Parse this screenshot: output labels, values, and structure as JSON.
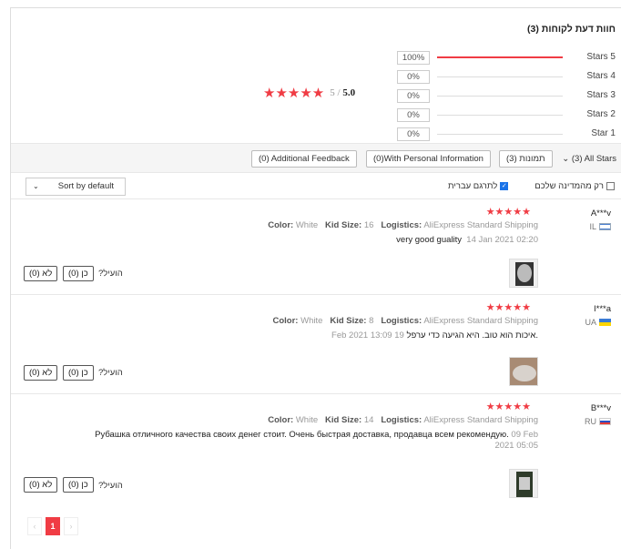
{
  "summary": {
    "title": "חוות דעת לקוחות (3)",
    "stars": "★★★★★",
    "score_max": "5 / ",
    "score": "5.0",
    "bars": [
      {
        "pct": "100%",
        "fill": 1.0,
        "label": "Stars 5"
      },
      {
        "pct": "0%",
        "fill": 0,
        "label": "Stars 4"
      },
      {
        "pct": "0%",
        "fill": 0,
        "label": "Stars 3"
      },
      {
        "pct": "0%",
        "fill": 0,
        "label": "Stars 2"
      },
      {
        "pct": "0%",
        "fill": 0,
        "label": "Star 1"
      }
    ]
  },
  "filters": {
    "additional_feedback": "(0) Additional Feedback",
    "personal_info": "(0)With Personal Information",
    "photos": "תמונות (3)",
    "all_stars": "(3) All Stars",
    "all_stars_icon": "chevron-down-icon"
  },
  "options": {
    "sort_label": "Sort by default",
    "from_country": "רק מהמדינה שלכם",
    "translate": "לתרגם עברית"
  },
  "reviews": [
    {
      "name": "A***v",
      "country": "IL",
      "stars": "★★★★★",
      "color_label": "Color:",
      "color": "White",
      "size_label": "Kid Size:",
      "size": "16",
      "logistics_label": "Logistics:",
      "logistics": "AliExpress Standard Shipping",
      "text": "very good guality",
      "date": "14 Jan 2021 02:20",
      "useful": "?הועיל",
      "yes": "כן (0)",
      "no": "לא (0)"
    },
    {
      "name": "I***a",
      "country": "UA",
      "stars": "★★★★★",
      "color_label": "Color:",
      "color": "White",
      "size_label": "Kid Size:",
      "size": "8",
      "logistics_label": "Logistics:",
      "logistics": "AliExpress Standard Shipping",
      "text": "איכות הוא טוב. היא הגיעה כדי ערפל.",
      "date": "Feb 2021 13:09 19",
      "useful": "?הועיל",
      "yes": "כן (0)",
      "no": "לא (0)"
    },
    {
      "name": "B***v",
      "country": "RU",
      "stars": "★★★★★",
      "color_label": "Color:",
      "color": "White",
      "size_label": "Kid Size:",
      "size": "14",
      "logistics_label": "Logistics:",
      "logistics": "AliExpress Standard Shipping",
      "text": "Рубашка отличного качества своих денег стоит. Очень быстрая доставка, продавца всем рекомендую.",
      "date": "09 Feb 2021 05:05",
      "useful": "?הועיל",
      "yes": "כן (0)",
      "no": "לא (0)"
    }
  ],
  "pagination": {
    "prev": "‹",
    "current": "1",
    "next": "›"
  },
  "colors": {
    "accent": "#f03c44"
  }
}
